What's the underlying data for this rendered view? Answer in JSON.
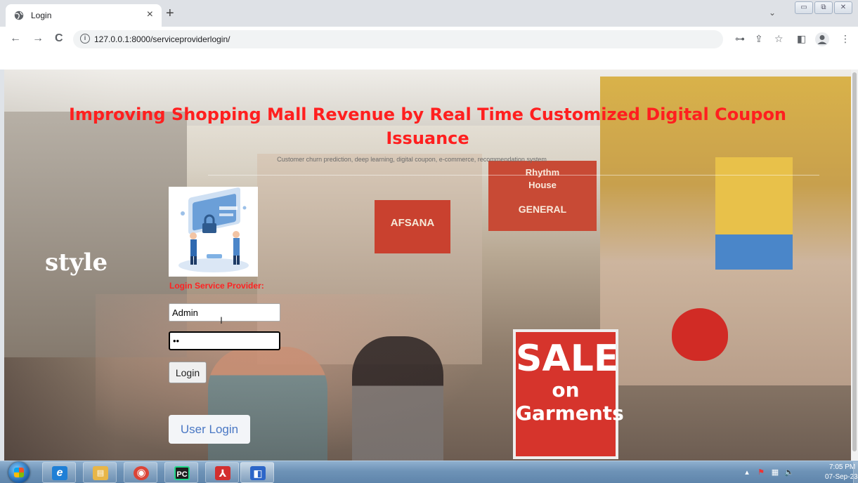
{
  "browser": {
    "tab": {
      "title": "Login",
      "close_glyph": "×",
      "icon": "globe-icon"
    },
    "new_tab_glyph": "+",
    "tab_search_glyph": "⌄",
    "window_controls": [
      "▭",
      "⧉",
      "✕"
    ],
    "nav": {
      "back": "←",
      "forward": "→",
      "reload": "C"
    },
    "address": {
      "info_glyph": "i",
      "url": "127.0.0.1:8000/serviceproviderlogin/"
    },
    "toolbar_icons": {
      "key": "⊶",
      "share": "⇪",
      "star": "☆",
      "sidepanel": "◧",
      "menu": "⋮"
    }
  },
  "page": {
    "title": "Improving Shopping Mall Revenue by Real Time Customized Digital Coupon Issuance",
    "subtitle": "Customer churn prediction, deep learning, digital coupon, e-commerce, recommendation system",
    "login_heading": "Login Service Provider:",
    "username_value": "Admin",
    "password_value": "••",
    "login_button": "Login",
    "user_login_link": "User Login",
    "scene": {
      "style_sign": "style",
      "afsana_sign": "AFSANA",
      "rhythm_sign_line1": "Rhythm",
      "rhythm_sign_line2": "House",
      "general_sign": "GENERAL",
      "sale_word": "SALE",
      "sale_on": "on",
      "sale_garments": "Garments"
    }
  },
  "taskbar": {
    "apps": [
      {
        "name": "internet-explorer",
        "glyph": "e",
        "color": "#1f7fd6"
      },
      {
        "name": "file-explorer",
        "glyph": "▤",
        "color": "#e8b648"
      },
      {
        "name": "chrome",
        "glyph": "◉",
        "color": "#db4437"
      },
      {
        "name": "pycharm",
        "glyph": "PC",
        "color": "#1e1e1e"
      },
      {
        "name": "acrobat",
        "glyph": "⅄",
        "color": "#d32f2f"
      },
      {
        "name": "snipping-tool",
        "glyph": "◧",
        "color": "#2d66c8"
      }
    ],
    "tray_glyphs": {
      "up": "▴",
      "flag": "⚑",
      "network": "▦",
      "volume": "🔈"
    },
    "time": "7:05 PM",
    "date": "07-Sep-23"
  }
}
